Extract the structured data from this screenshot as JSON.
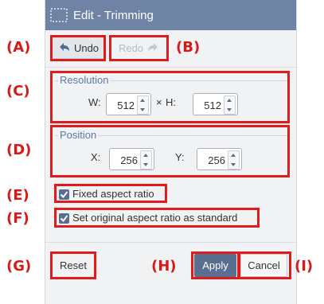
{
  "window": {
    "title": "Edit - Trimming"
  },
  "toolbar": {
    "undo_label": "Undo",
    "redo_label": "Redo"
  },
  "resolution": {
    "legend": "Resolution",
    "w_label": "W:",
    "w_value": "512",
    "times": "×",
    "h_label": "H:",
    "h_value": "512"
  },
  "position": {
    "legend": "Position",
    "x_label": "X:",
    "x_value": "256",
    "y_label": "Y:",
    "y_value": "256"
  },
  "options": {
    "fixed_aspect_label": "Fixed aspect ratio",
    "fixed_aspect_checked": true,
    "original_aspect_label": "Set original aspect ratio as standard",
    "original_aspect_checked": true
  },
  "footer": {
    "reset_label": "Reset",
    "apply_label": "Apply",
    "cancel_label": "Cancel"
  },
  "annotations": {
    "A": "(A)",
    "B": "(B)",
    "C": "(C)",
    "D": "(D)",
    "E": "(E)",
    "F": "(F)",
    "G": "(G)",
    "H": "(H)",
    "I": "(I)"
  },
  "colors": {
    "titlebar": "#6f84a5",
    "accent": "#4f6a92",
    "annotation_red": "#e01b1b"
  }
}
